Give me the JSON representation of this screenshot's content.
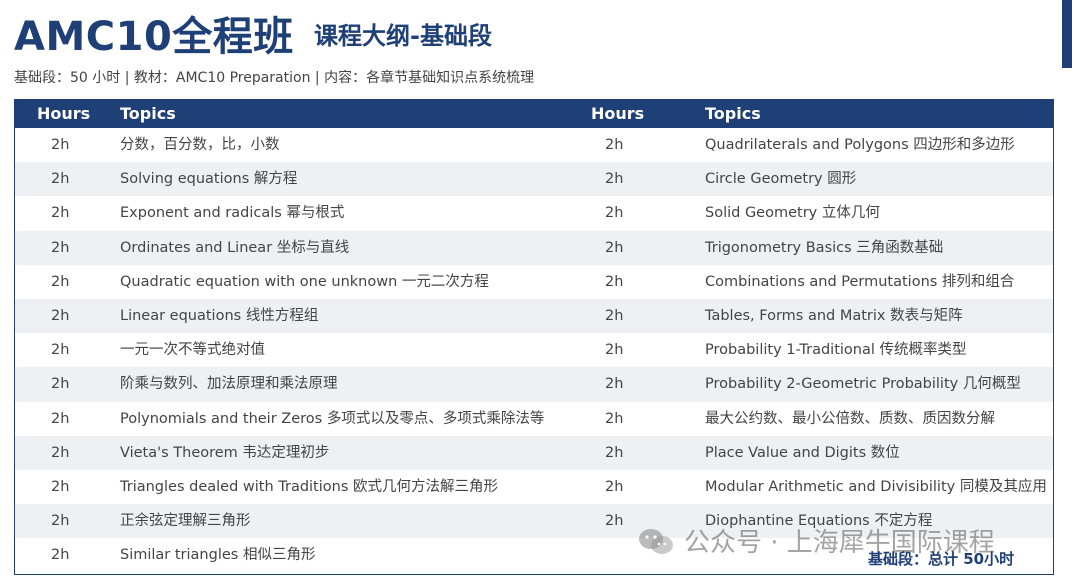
{
  "header": {
    "title": "AMC10全程班",
    "subtitle": "课程大纲-基础段",
    "info": "基础段：50 小时 | 教材：AMC10 Preparation | 内容：各章节基础知识点系统梳理",
    "accent_color": "#1f3f77"
  },
  "table": {
    "columns": [
      "Hours",
      "Topics",
      "Hours",
      "Topics"
    ],
    "rows": [
      {
        "h1": "2h",
        "t1": "分数，百分数，比，小数",
        "h2": "2h",
        "t2": "Quadrilaterals and Polygons 四边形和多边形"
      },
      {
        "h1": "2h",
        "t1": "Solving equations 解方程",
        "h2": "2h",
        "t2": "Circle Geometry 圆形"
      },
      {
        "h1": "2h",
        "t1": "Exponent and radicals 幂与根式",
        "h2": "2h",
        "t2": "Solid Geometry 立体几何"
      },
      {
        "h1": "2h",
        "t1": "Ordinates and Linear 坐标与直线",
        "h2": "2h",
        "t2": "Trigonometry Basics 三角函数基础"
      },
      {
        "h1": "2h",
        "t1": "Quadratic equation with one unknown 一元二次方程",
        "h2": "2h",
        "t2": "Combinations and Permutations 排列和组合"
      },
      {
        "h1": "2h",
        "t1": "Linear equations 线性方程组",
        "h2": "2h",
        "t2": "Tables, Forms and Matrix 数表与矩阵"
      },
      {
        "h1": "2h",
        "t1": "一元一次不等式绝对值",
        "h2": "2h",
        "t2": "Probability 1-Traditional 传统概率类型"
      },
      {
        "h1": "2h",
        "t1": "阶乘与数列、加法原理和乘法原理",
        "h2": "2h",
        "t2": "Probability 2-Geometric Probability 几何概型"
      },
      {
        "h1": "2h",
        "t1": "Polynomials and their Zeros 多项式以及零点、多项式乘除法等",
        "h2": "2h",
        "t2": "最大公约数、最小公倍数、质数、质因数分解"
      },
      {
        "h1": "2h",
        "t1": "Vieta's Theorem 韦达定理初步",
        "h2": "2h",
        "t2": "Place Value and Digits 数位"
      },
      {
        "h1": "2h",
        "t1": "Triangles dealed with Traditions 欧式几何方法解三角形",
        "h2": "2h",
        "t2": "Modular Arithmetic and Divisibility 同模及其应用"
      },
      {
        "h1": "2h",
        "t1": "正余弦定理解三角形",
        "h2": "2h",
        "t2": "Diophantine Equations 不定方程"
      },
      {
        "h1": "2h",
        "t1": "Similar triangles 相似三角形",
        "h2": "",
        "t2": ""
      }
    ]
  },
  "total": "基础段：总计 50小时",
  "watermark": "公众号 · 上海犀牛国际课程",
  "icons": {
    "watermark": "wechat-icon"
  }
}
